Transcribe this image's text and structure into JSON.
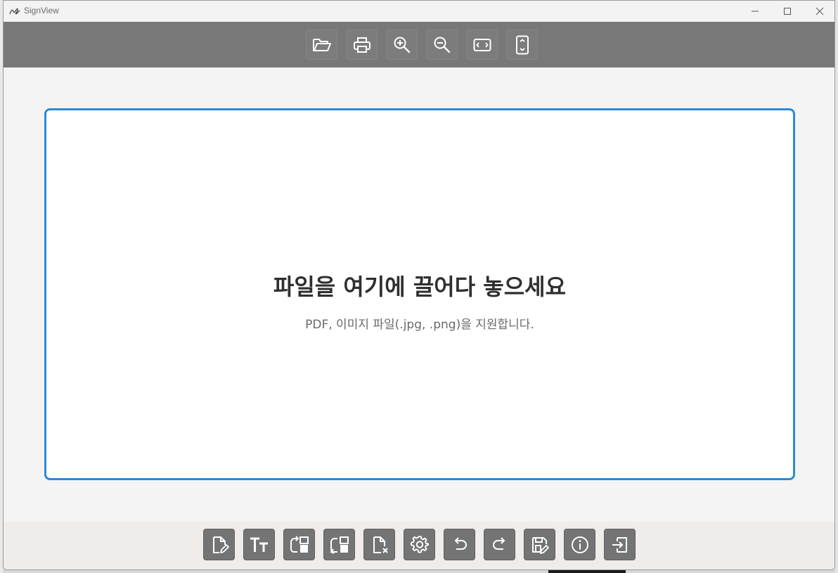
{
  "window": {
    "title": "SignView"
  },
  "top_toolbar": {
    "buttons": [
      {
        "name": "open-folder",
        "icon": "folder-open-icon"
      },
      {
        "name": "print",
        "icon": "printer-icon"
      },
      {
        "name": "zoom-in",
        "icon": "zoom-in-icon"
      },
      {
        "name": "zoom-out",
        "icon": "zoom-out-icon"
      },
      {
        "name": "fit-width",
        "icon": "fit-width-icon"
      },
      {
        "name": "fit-height",
        "icon": "fit-height-icon"
      }
    ]
  },
  "dropzone": {
    "title": "파일을 여기에 끌어다 놓으세요",
    "subtitle": "PDF, 이미지 파일(.jpg, .png)을 지원합니다.",
    "border_color": "#2b8ad4"
  },
  "bottom_toolbar": {
    "buttons": [
      {
        "name": "sign-document",
        "icon": "document-edit-icon"
      },
      {
        "name": "text",
        "icon": "text-size-icon"
      },
      {
        "name": "rotate-right",
        "icon": "rotate-right-icon"
      },
      {
        "name": "rotate-left",
        "icon": "rotate-left-icon"
      },
      {
        "name": "close-document",
        "icon": "document-close-icon"
      },
      {
        "name": "settings",
        "icon": "gear-icon"
      },
      {
        "name": "undo",
        "icon": "undo-icon"
      },
      {
        "name": "redo",
        "icon": "redo-icon"
      },
      {
        "name": "save-signed",
        "icon": "save-edit-icon"
      },
      {
        "name": "info",
        "icon": "info-icon"
      },
      {
        "name": "exit",
        "icon": "exit-icon"
      }
    ]
  },
  "colors": {
    "toolbar_top_bg": "#787878",
    "button_bg": "#747474",
    "accent": "#2b8ad4"
  }
}
